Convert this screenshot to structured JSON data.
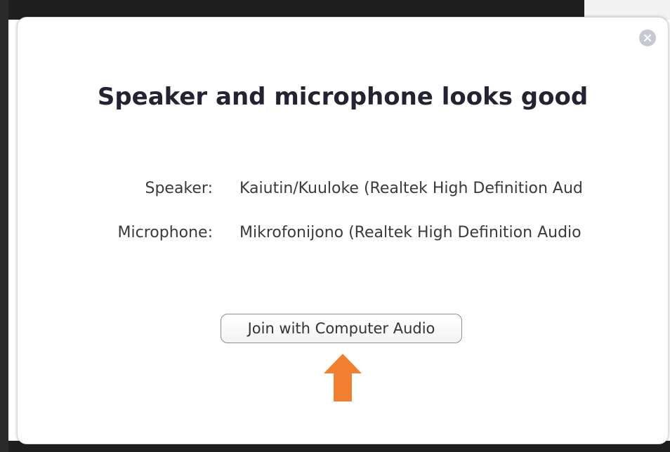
{
  "dialog": {
    "title": "Speaker and microphone looks good",
    "close_icon": "close-icon",
    "speaker": {
      "label": "Speaker:",
      "value": "Kaiutin/Kuuloke (Realtek High Definition Aud"
    },
    "microphone": {
      "label": "Microphone:",
      "value": "Mikrofonijono (Realtek High Definition Audio"
    },
    "join_button_label": "Join with Computer Audio",
    "arrow_icon": "up-arrow-icon"
  },
  "colors": {
    "arrow": "#f07f2f",
    "close_bg": "#c6c9d0",
    "title": "#232333"
  }
}
